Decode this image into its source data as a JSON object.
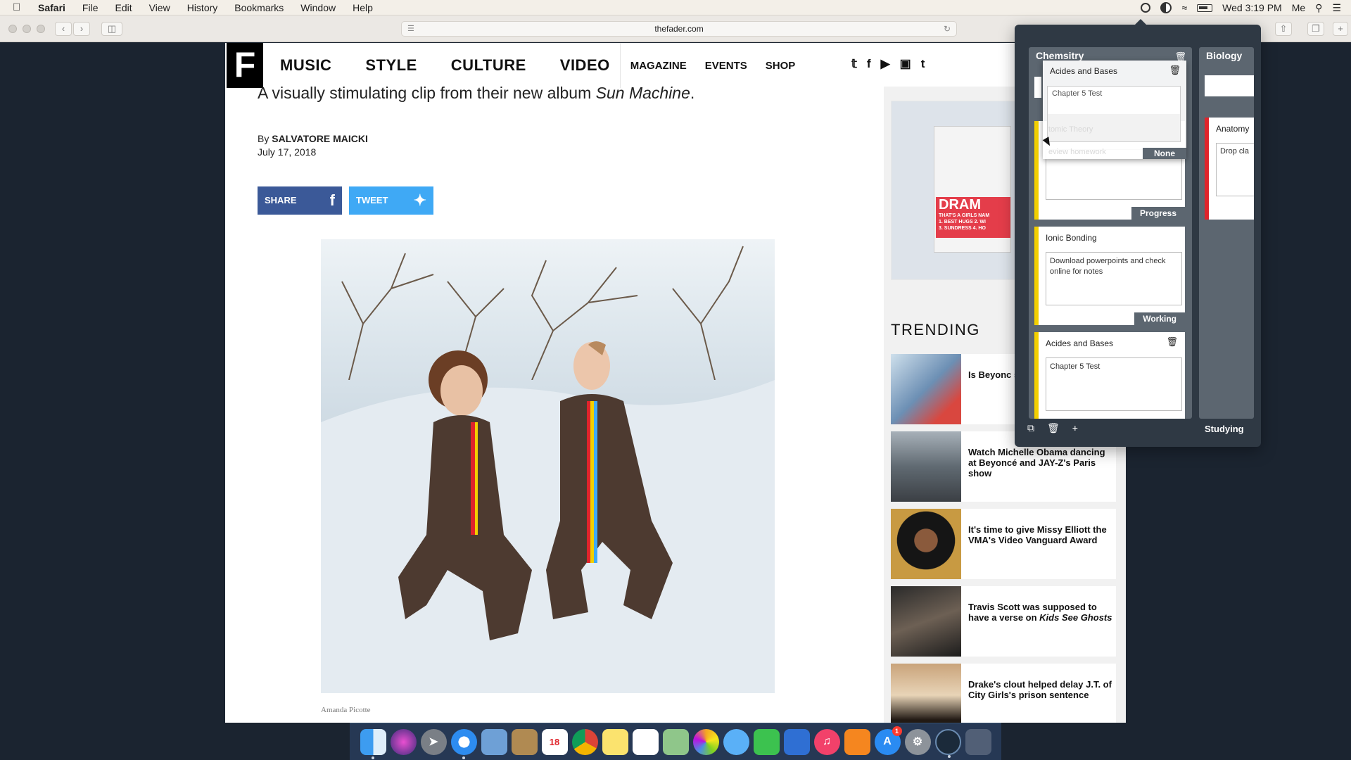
{
  "menubar": {
    "items": [
      "Safari",
      "File",
      "Edit",
      "View",
      "History",
      "Bookmarks",
      "Window",
      "Help"
    ],
    "clock": "Wed 3:19 PM",
    "user": "Me"
  },
  "browser": {
    "url": "thefader.com"
  },
  "site": {
    "logo": "F",
    "nav_primary": [
      "MUSIC",
      "STYLE",
      "CULTURE",
      "VIDEO"
    ],
    "nav_secondary": [
      "MAGAZINE",
      "EVENTS",
      "SHOP"
    ],
    "social_icons": [
      "twitter-icon",
      "facebook-icon",
      "youtube-icon",
      "instagram-icon",
      "tumblr-icon"
    ],
    "deck_prefix": "A visually stimulating clip from their new album ",
    "deck_album": "Sun Machine",
    "deck_suffix": ".",
    "byline_prefix": "By ",
    "byline_author": "SALVATORE MAICKI",
    "date": "July 17, 2018",
    "share_label": "SHARE",
    "tweet_label": "TWEET",
    "photo_credit": "Amanda Picotte",
    "ad_title": "DRAM",
    "ad_subtitle": "THAT'S A GIRLS NAM",
    "ad_lines": [
      "1. BEST HUGS  2. WI",
      "3. SUNDRESS  4. HO"
    ],
    "trending_title": "TRENDING",
    "trending": [
      {
        "title": "Is Beyonc somethir photos?"
      },
      {
        "title": "Watch Michelle Obama dancing at Beyoncé and JAY-Z's Paris show"
      },
      {
        "title": "It's time to give Missy Elliott the VMA's Video Vanguard Award"
      },
      {
        "title_prefix": "Travis Scott was supposed to have a verse on ",
        "title_em": "Kids See Ghosts"
      },
      {
        "title": "Drake's clout helped delay J.T. of City Girls's prison sentence"
      }
    ]
  },
  "planner": {
    "columns": [
      {
        "title": "Chemsitry"
      },
      {
        "title": "Biology"
      }
    ],
    "drag_card": {
      "title": "Acides and Bases",
      "text": "Chapter 5 Test",
      "ghost_title": "tomic Theory",
      "ghost_text": "eview homework",
      "status": "None"
    },
    "cards": [
      {
        "status": "Progress"
      },
      {
        "title": "Ionic Bonding",
        "text": "Download powerpoints and check online for notes",
        "status": "Working"
      },
      {
        "title": "Acides and Bases",
        "text": "Chapter 5 Test"
      }
    ],
    "bio_card": {
      "title": "Anatomy",
      "text": "Drop cla"
    },
    "footer_label": "Studying"
  },
  "dock": {
    "calendar_day": "18",
    "app_store_badge": "1",
    "colors": {
      "accent_yellow": "#f2cf00",
      "accent_red": "#e0242b",
      "facebook_blue": "#3b5998",
      "twitter_blue": "#3fa9f5"
    }
  }
}
